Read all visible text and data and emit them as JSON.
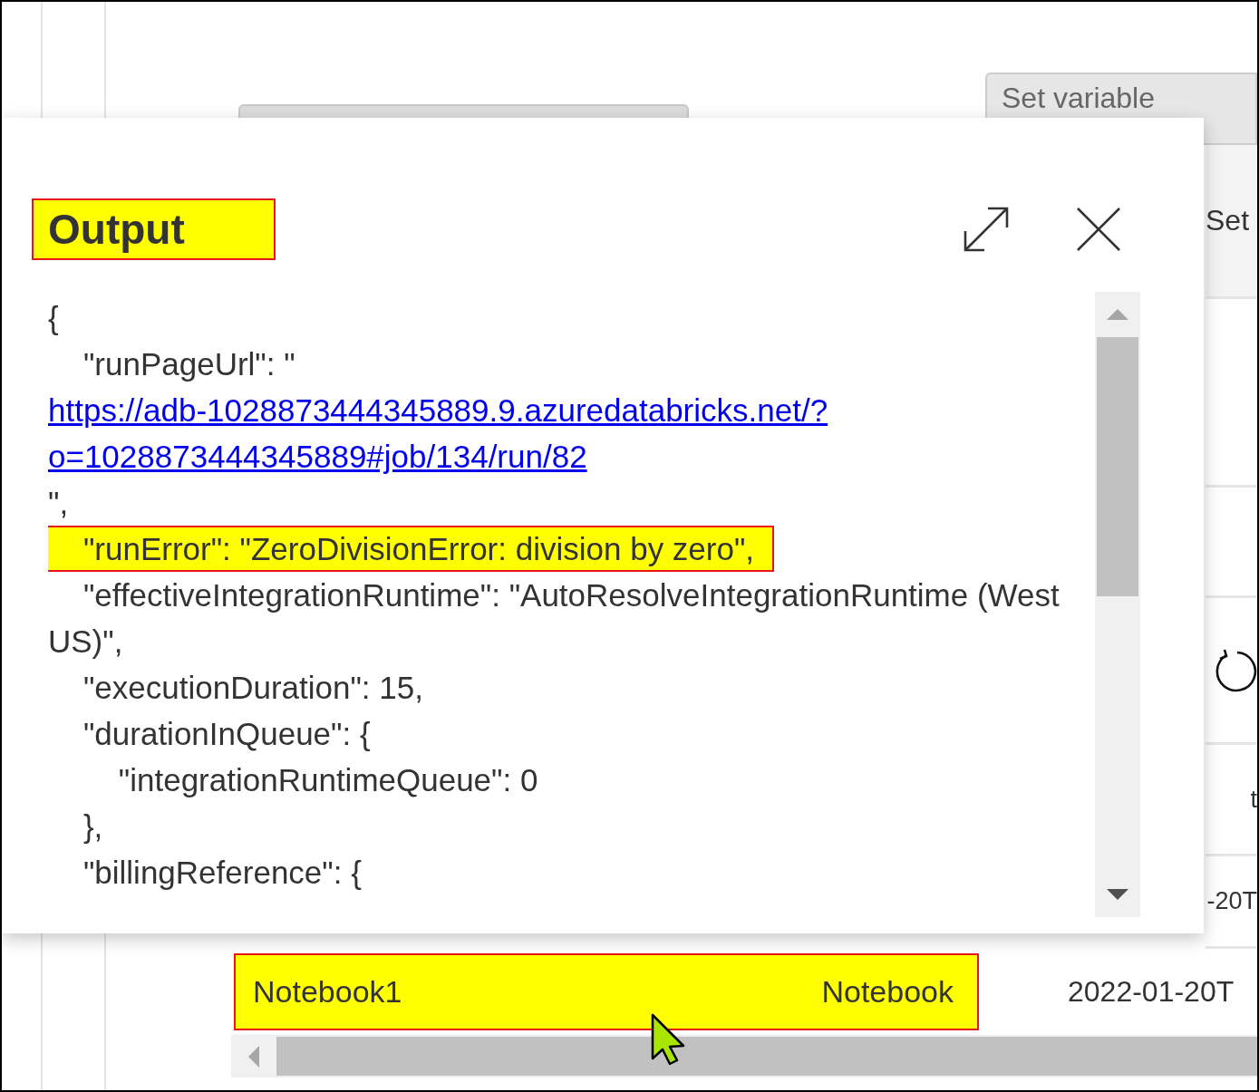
{
  "background": {
    "activity_node": "Set variable",
    "right_column": [
      {
        "kind": "text",
        "text": "Set"
      },
      {
        "kind": "blank"
      },
      {
        "kind": "blank"
      },
      {
        "kind": "refresh"
      },
      {
        "kind": "text",
        "text": "t"
      },
      {
        "kind": "text",
        "text": "-20T"
      }
    ],
    "activity_row": {
      "name": "Notebook1",
      "type": "Notebook",
      "highlighted": true,
      "start_time": "2022-01-20T"
    }
  },
  "dialog": {
    "title": "Output",
    "title_highlighted": true,
    "code_lines": [
      {
        "text": "{",
        "highlighted": false
      },
      {
        "text": "    \"runPageUrl\": \"",
        "link": "https://adb-1028873444345889.9.azuredatabricks.net/?o=1028873444345889#job/134/run/82",
        "after": "\",",
        "highlighted": false
      },
      {
        "text": "    \"runError\": \"ZeroDivisionError: division by zero\",",
        "highlighted": true
      },
      {
        "text": "    \"effectiveIntegrationRuntime\": \"AutoResolveIntegrationRuntime (West US)\",",
        "highlighted": false
      },
      {
        "text": "    \"executionDuration\": 15,",
        "highlighted": false
      },
      {
        "text": "    \"durationInQueue\": {",
        "highlighted": false
      },
      {
        "text": "        \"integrationRuntimeQueue\": 0",
        "highlighted": false
      },
      {
        "text": "    },",
        "highlighted": false
      },
      {
        "text": "    \"billingReference\": {",
        "highlighted": false
      }
    ]
  }
}
